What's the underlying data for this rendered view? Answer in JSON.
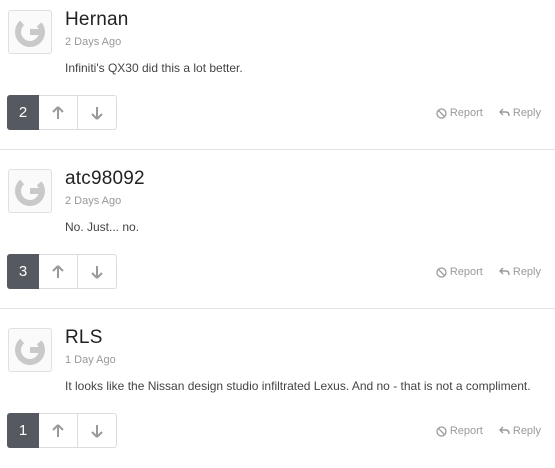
{
  "comments": [
    {
      "username": "Hernan",
      "time": "2 Days Ago",
      "text": "Infiniti's QX30 did this a lot better.",
      "votes": "2",
      "report": "Report",
      "reply": "Reply"
    },
    {
      "username": "atc98092",
      "time": "2 Days Ago",
      "text": "No. Just... no.",
      "votes": "3",
      "report": "Report",
      "reply": "Reply"
    },
    {
      "username": "RLS",
      "time": "1 Day Ago",
      "text": "It looks like the Nissan design studio infiltrated Lexus. And no - that is not a compliment.",
      "votes": "1",
      "report": "Report",
      "reply": "Reply"
    }
  ],
  "icons": {
    "avatar": "default-avatar-icon",
    "upvote": "arrow-up-icon",
    "downvote": "arrow-down-icon",
    "report": "ban-icon",
    "reply": "reply-arrow-icon"
  },
  "colors": {
    "vote_bg": "#555a60",
    "muted": "#9a9a9a"
  }
}
